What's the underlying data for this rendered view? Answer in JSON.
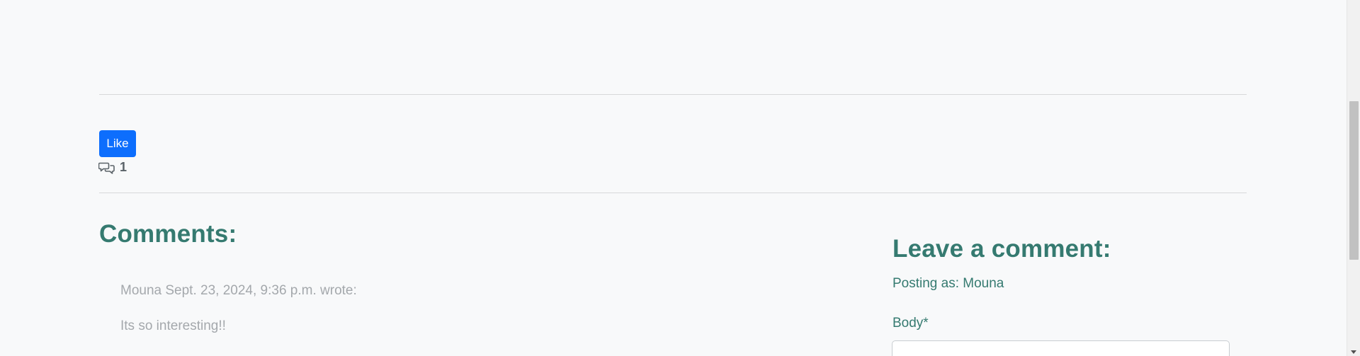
{
  "post": {
    "like_label": "Like",
    "comment_count": "1",
    "comment_icon": "chat-bubbles-icon"
  },
  "comments": {
    "heading": "Comments:",
    "items": [
      {
        "meta": "Mouna Sept. 23, 2024, 9:36 p.m. wrote:",
        "body": "Its so interesting!!"
      }
    ]
  },
  "comment_form": {
    "heading": "Leave a comment:",
    "posting_as": "Posting as: Mouna",
    "body_label": "Body*",
    "body_value": ""
  },
  "colors": {
    "accent": "#357a70",
    "primary_button": "#0d6efd",
    "muted_text": "#a4a8ac",
    "background": "#f8f9fa"
  }
}
